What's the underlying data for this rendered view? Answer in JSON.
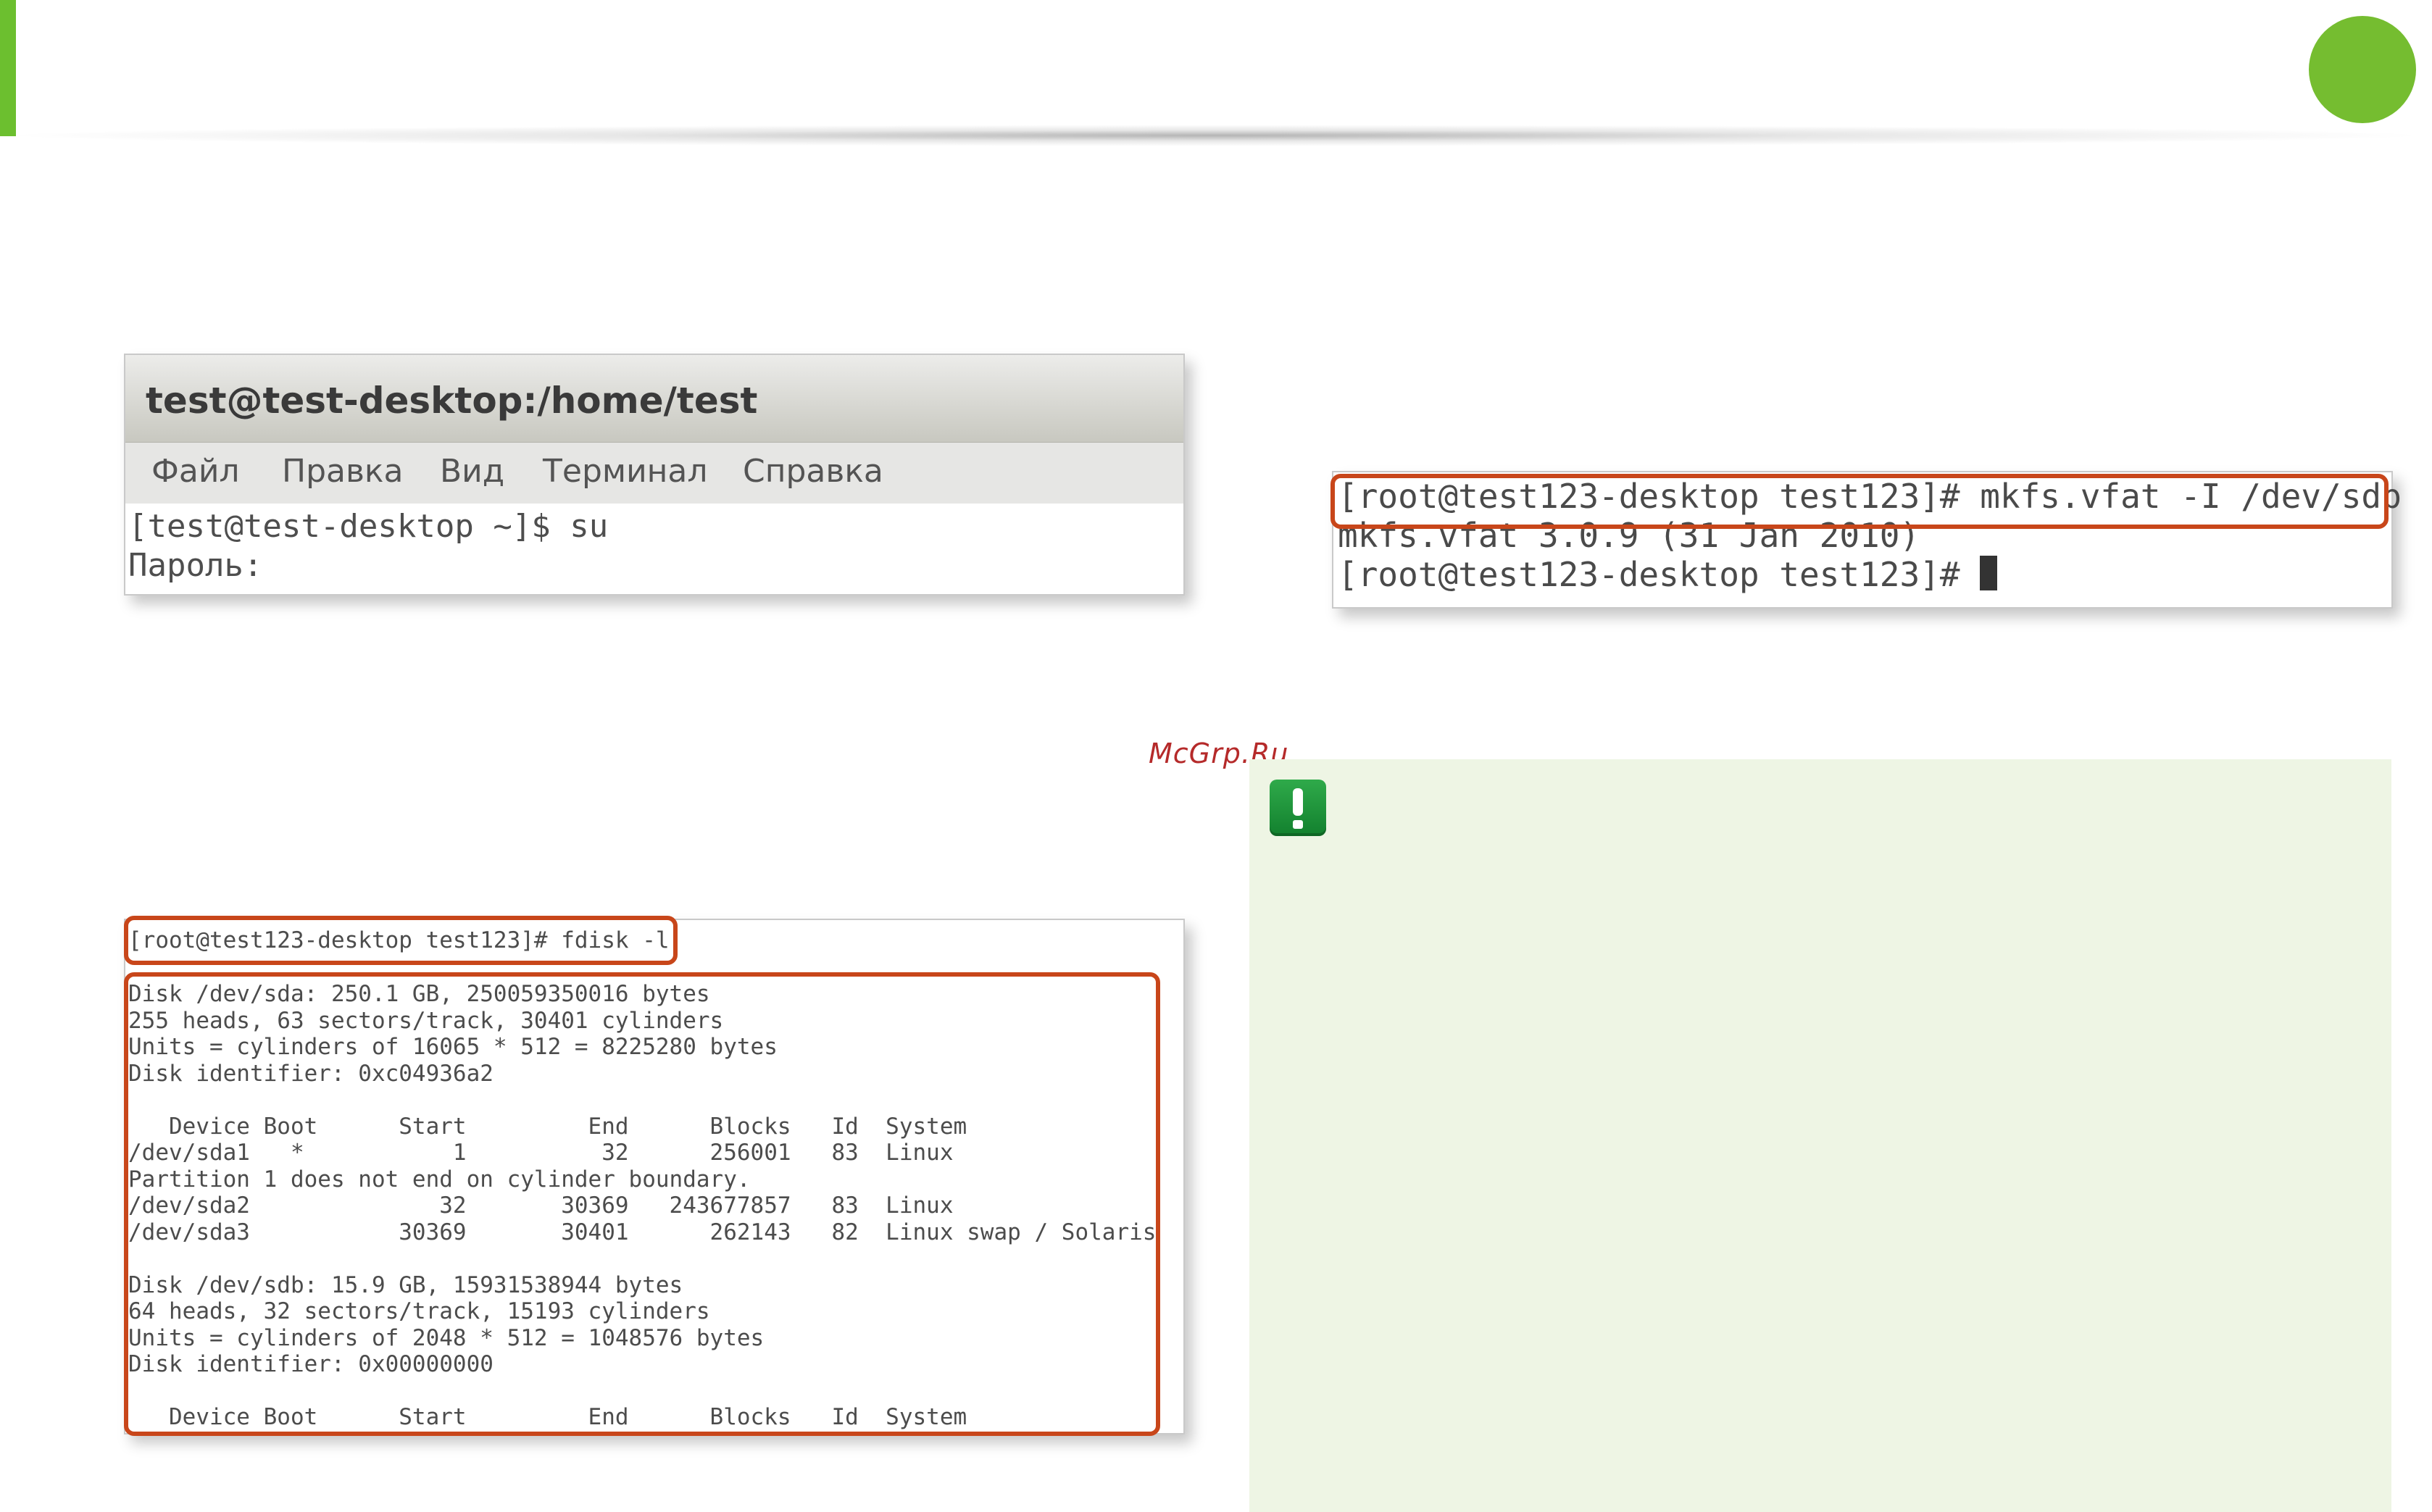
{
  "window1": {
    "title": "test@test-desktop:/home/test",
    "menu": [
      "Файл",
      "Правка",
      "Вид",
      "Терминал",
      "Справка"
    ],
    "lines": [
      "[test@test-desktop ~]$ su",
      "Пароль:"
    ]
  },
  "window2": {
    "lines": [
      "[root@test123-desktop test123]# mkfs.vfat -I /dev/sdb",
      "mkfs.vfat 3.0.9 (31 Jan 2010)",
      "[root@test123-desktop test123]# "
    ]
  },
  "window3": {
    "command": "[root@test123-desktop test123]# fdisk -l",
    "output": [
      "Disk /dev/sda: 250.1 GB, 250059350016 bytes",
      "255 heads, 63 sectors/track, 30401 cylinders",
      "Units = cylinders of 16065 * 512 = 8225280 bytes",
      "Disk identifier: 0xc04936a2",
      "",
      "   Device Boot      Start         End      Blocks   Id  System",
      "/dev/sda1   *           1          32      256001   83  Linux",
      "Partition 1 does not end on cylinder boundary.",
      "/dev/sda2              32       30369   243677857   83  Linux",
      "/dev/sda3           30369       30401      262143   82  Linux swap / Solaris",
      "",
      "Disk /dev/sdb: 15.9 GB, 15931538944 bytes",
      "64 heads, 32 sectors/track, 15193 cylinders",
      "Units = cylinders of 2048 * 512 = 1048576 bytes",
      "Disk identifier: 0x00000000",
      "",
      "   Device Boot      Start         End      Blocks   Id  System"
    ]
  },
  "watermark": "McGrp.Ru",
  "colors": {
    "accent_green": "#6cbf2f",
    "highlight_orange": "#c8461a",
    "note_background": "#eef5e4"
  },
  "icons": {
    "note": "exclamation-icon"
  }
}
